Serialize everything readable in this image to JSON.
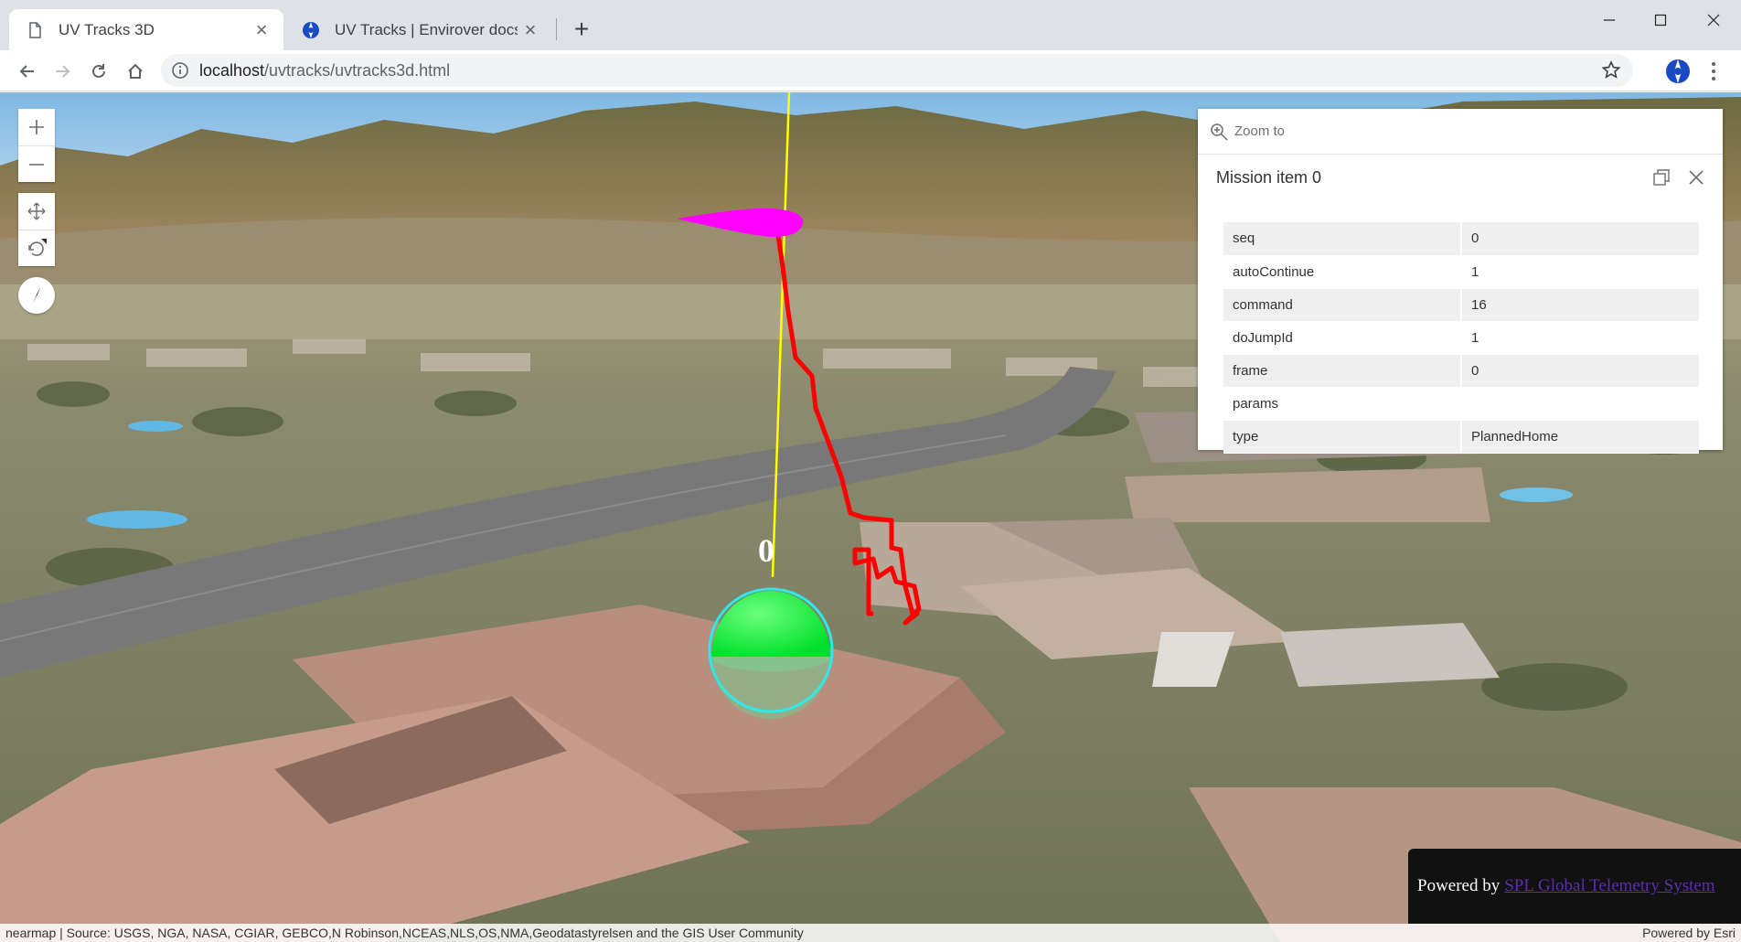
{
  "browser": {
    "tabs": [
      {
        "title": "UV Tracks 3D",
        "close": "×"
      },
      {
        "title": "UV Tracks | Envirover docs",
        "close": "×"
      }
    ],
    "new_tab": "+",
    "url_host": "localhost",
    "url_path": "/uvtracks/uvtracks3d.html"
  },
  "scene": {
    "waypoint_label": "0",
    "search_placeholder": "Zoom to"
  },
  "popup": {
    "title": "Mission item 0",
    "attributes": [
      {
        "name": "seq",
        "value": "0"
      },
      {
        "name": "autoContinue",
        "value": "1"
      },
      {
        "name": "command",
        "value": "16"
      },
      {
        "name": "doJumpId",
        "value": "1"
      },
      {
        "name": "frame",
        "value": "0"
      },
      {
        "name": "params",
        "value": ""
      },
      {
        "name": "type",
        "value": "PlannedHome"
      }
    ]
  },
  "footer": {
    "powered_by": "Powered by",
    "powered_link": "SPL Global Telemetry System",
    "attribution": "nearmap | Source: USGS, NGA, NASA, CGIAR, GEBCO,N Robinson,NCEAS,NLS,OS,NMA,Geodatastyrelsen and the GIS User Community",
    "esri": "Powered by Esri"
  },
  "colors": {
    "track": "#ff0000",
    "vehicle_marker": "#ff00ff",
    "home_sphere": "#00ff2a",
    "sphere_outline": "#2fe8e8",
    "plumb_line": "#ffff00"
  }
}
